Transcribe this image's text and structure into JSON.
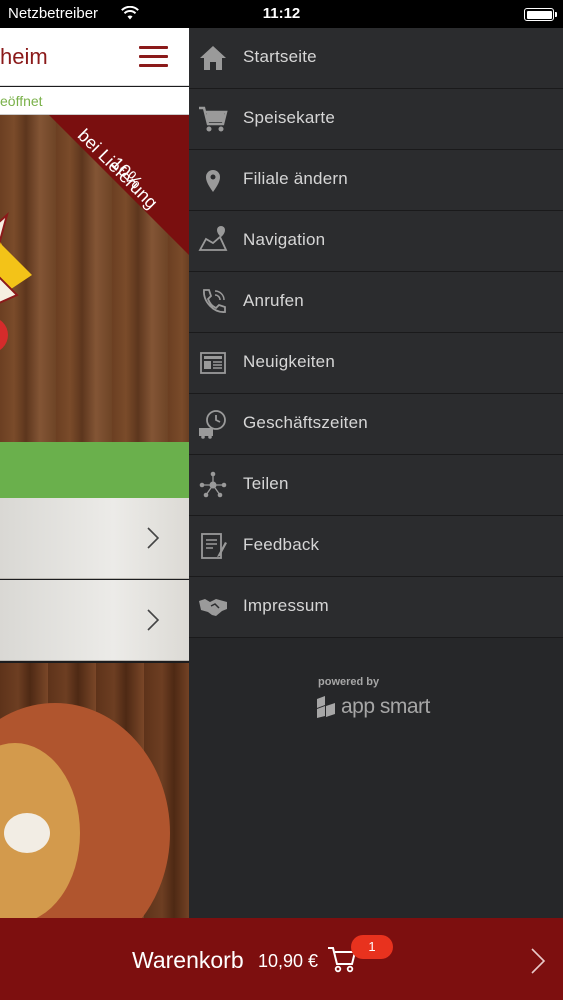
{
  "status_bar": {
    "carrier": "Netzbetreiber",
    "time": "11:12"
  },
  "background_page": {
    "brand_fragment": "heim",
    "open_status_fragment": "eöffnet",
    "promo_percent": "10%",
    "promo_text": "bei Lieferung"
  },
  "drawer": {
    "items": [
      {
        "label": "Startseite",
        "icon": "home-icon"
      },
      {
        "label": "Speisekarte",
        "icon": "cart-icon"
      },
      {
        "label": "Filiale ändern",
        "icon": "location-pin-icon"
      },
      {
        "label": "Navigation",
        "icon": "map-icon"
      },
      {
        "label": "Anrufen",
        "icon": "phone-icon"
      },
      {
        "label": "Neuigkeiten",
        "icon": "newspaper-icon"
      },
      {
        "label": "Geschäftszeiten",
        "icon": "delivery-clock-icon"
      },
      {
        "label": "Teilen",
        "icon": "share-icon"
      },
      {
        "label": "Feedback",
        "icon": "feedback-form-icon"
      },
      {
        "label": "Impressum",
        "icon": "handshake-icon"
      }
    ],
    "powered_by": "powered by",
    "brand": "app smart"
  },
  "cart_bar": {
    "label": "Warenkorb",
    "price": "10,90 €",
    "count": "1"
  },
  "colors": {
    "brand_red": "#7d0f0f",
    "drawer_bg": "#2b2c2e",
    "open_green": "#6ab04c",
    "badge_red": "#e8321e"
  }
}
